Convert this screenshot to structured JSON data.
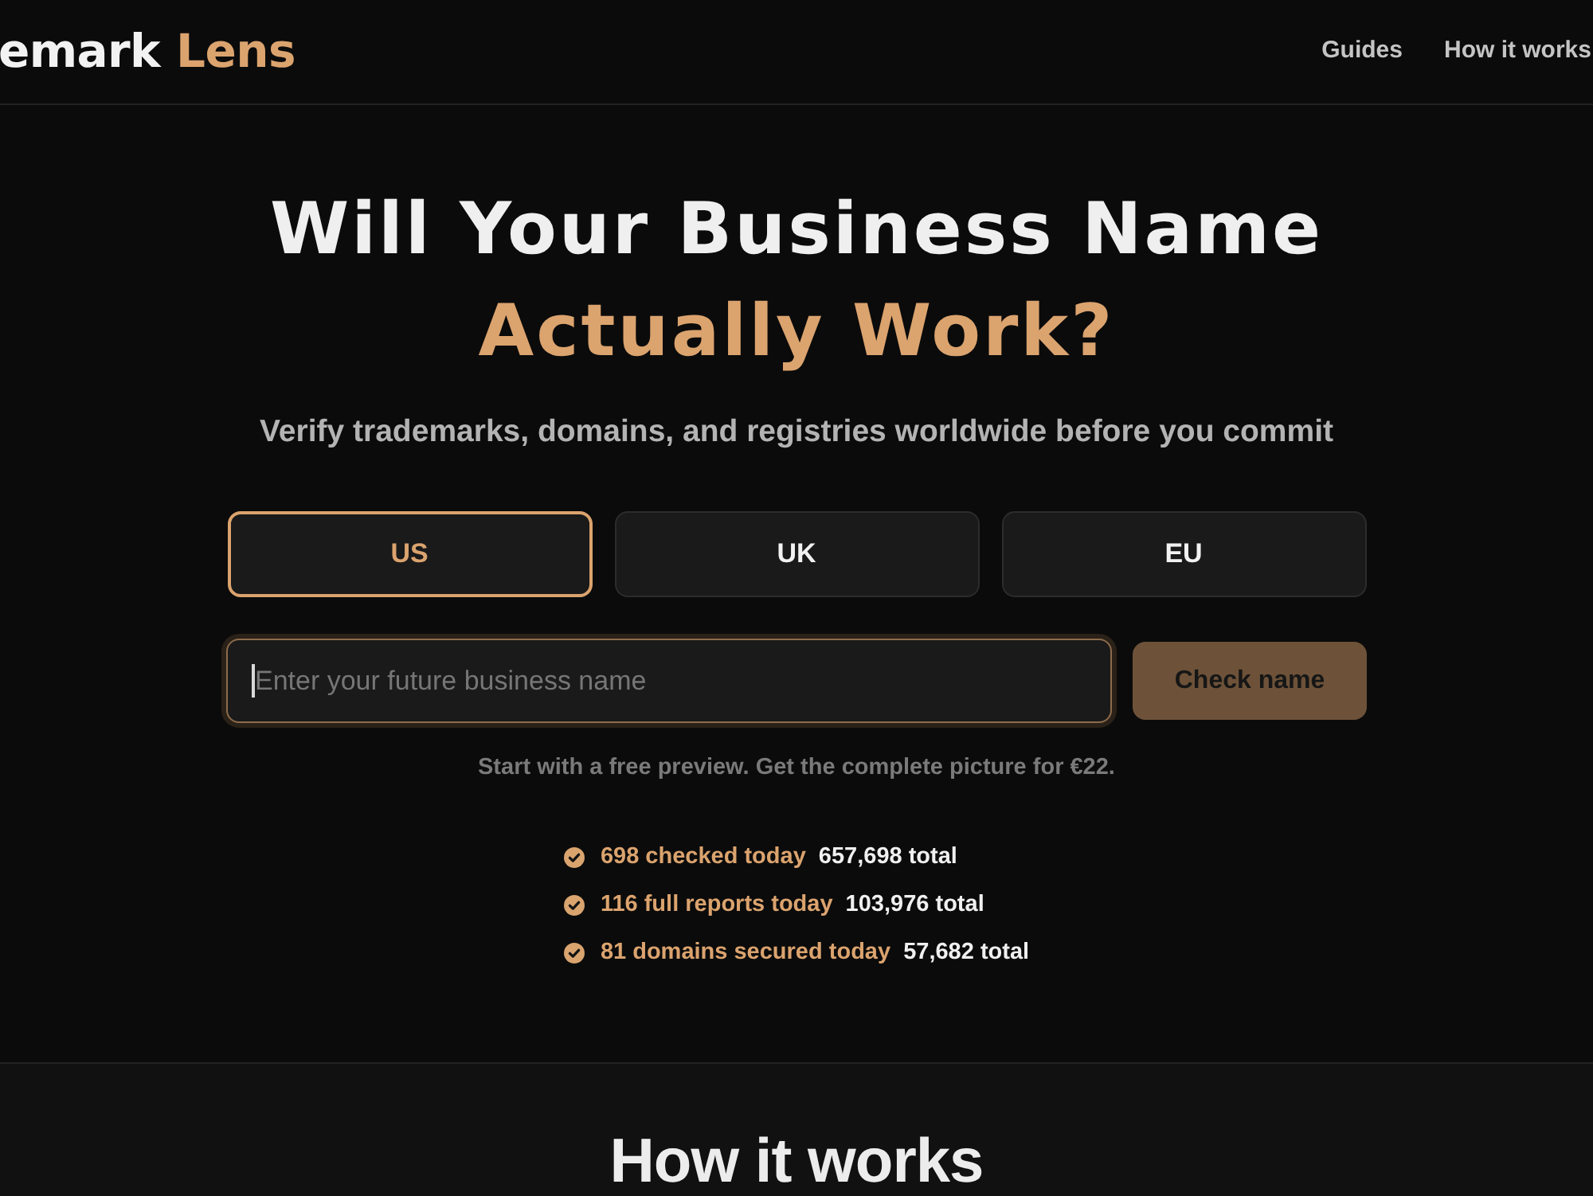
{
  "header": {
    "logo": {
      "text": "emark",
      "accent": "Lens"
    },
    "nav": [
      {
        "label": "Guides"
      },
      {
        "label": "How it works"
      }
    ]
  },
  "hero": {
    "title": "Will Your Business Name",
    "title_accent": "Actually Work?",
    "subtitle": "Verify trademarks, domains, and registries worldwide before you commit",
    "regions": [
      {
        "label": "US",
        "selected": true
      },
      {
        "label": "UK",
        "selected": false
      },
      {
        "label": "EU",
        "selected": false
      }
    ],
    "search": {
      "placeholder": "Enter your future business name",
      "focused": true
    },
    "button": "Check name",
    "note": "Start with a free preview. Get the complete picture for €22.",
    "stats": [
      {
        "today": "698 checked today",
        "total": "657,698 total"
      },
      {
        "today": "116 full reports today",
        "total": "103,976 total"
      },
      {
        "today": "81 domains secured today",
        "total": "57,682 total"
      }
    ]
  },
  "section": {
    "title": "How it works"
  }
}
